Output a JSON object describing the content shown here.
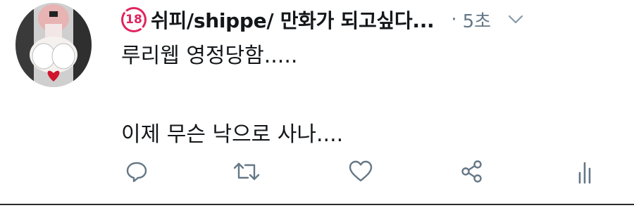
{
  "tweet": {
    "author": {
      "badge": "18",
      "display_name": "쉬피/shippe/ 만화가 되고싶다...",
      "avatar_icon": "avatar-icon"
    },
    "separator": "·",
    "timestamp": "5초",
    "text_lines": [
      "루리웹 영정당함.....",
      "",
      "이제 무슨 낙으로 사나...."
    ],
    "actions": {
      "reply_icon": "reply-icon",
      "retweet_icon": "retweet-icon",
      "like_icon": "heart-icon",
      "share_icon": "share-icon",
      "analytics_icon": "analytics-icon"
    },
    "colors": {
      "icon": "#657786",
      "text": "#14171a",
      "muted": "#657786",
      "badge": "#e0245e"
    }
  }
}
